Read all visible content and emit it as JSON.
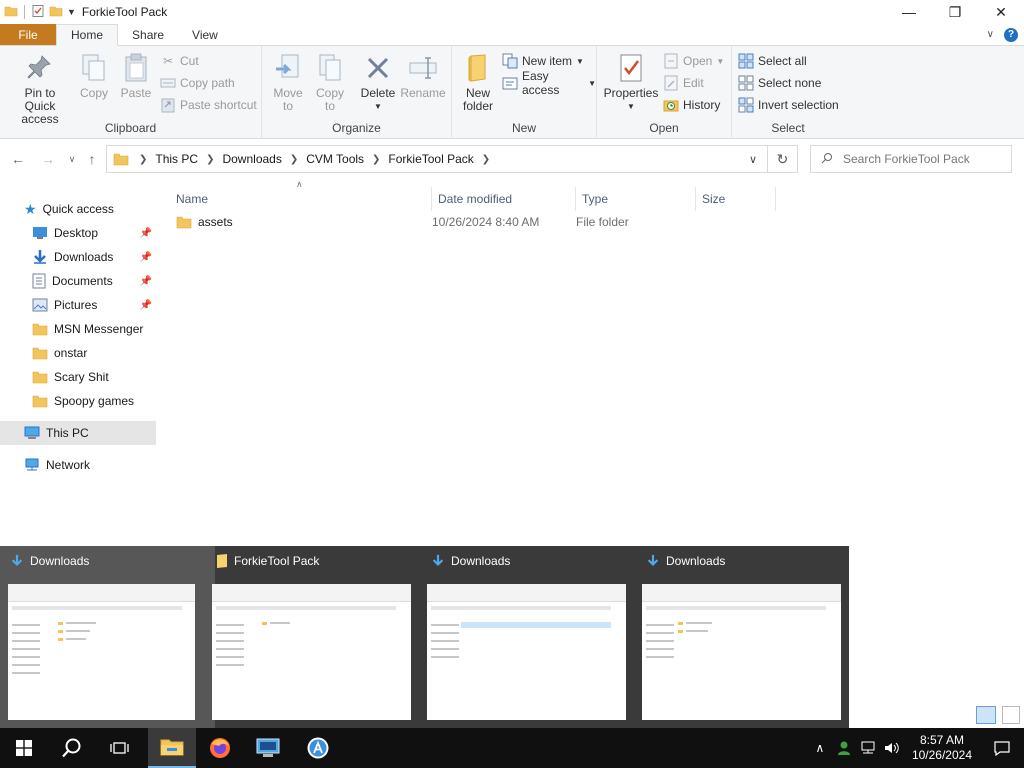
{
  "window": {
    "title": "ForkieTool Pack",
    "minimize": "—",
    "maximize": "❐",
    "close": "✕"
  },
  "tabs": [
    {
      "label": "File"
    },
    {
      "label": "Home"
    },
    {
      "label": "Share"
    },
    {
      "label": "View"
    }
  ],
  "ribbon": {
    "clipboard": {
      "label": "Clipboard",
      "pin": "Pin to Quick access",
      "copy": "Copy",
      "paste": "Paste",
      "cut": "Cut",
      "copy_path": "Copy path",
      "paste_shortcut": "Paste shortcut"
    },
    "organize": {
      "label": "Organize",
      "move_to": "Move to",
      "copy_to": "Copy to",
      "delete": "Delete",
      "rename": "Rename"
    },
    "new": {
      "label": "New",
      "new_folder": "New folder",
      "new_item": "New item",
      "easy_access": "Easy access"
    },
    "open": {
      "label": "Open",
      "properties": "Properties",
      "open": "Open",
      "edit": "Edit",
      "history": "History"
    },
    "select": {
      "label": "Select",
      "select_all": "Select all",
      "select_none": "Select none",
      "invert": "Invert selection"
    }
  },
  "address": {
    "crumbs": [
      "This PC",
      "Downloads",
      "CVM Tools",
      "ForkieTool Pack"
    ],
    "search_placeholder": "Search ForkieTool Pack"
  },
  "navpane": {
    "quick_access": "Quick access",
    "items": [
      {
        "label": "Desktop",
        "pinned": true
      },
      {
        "label": "Downloads",
        "pinned": true
      },
      {
        "label": "Documents",
        "pinned": true
      },
      {
        "label": "Pictures",
        "pinned": true
      },
      {
        "label": "MSN Messenger",
        "pinned": false
      },
      {
        "label": "onstar",
        "pinned": false
      },
      {
        "label": "Scary Shit",
        "pinned": false
      },
      {
        "label": "Spoopy games",
        "pinned": false
      }
    ],
    "this_pc": "This PC",
    "network": "Network"
  },
  "filelist": {
    "columns": [
      "Name",
      "Date modified",
      "Type",
      "Size"
    ],
    "rows": [
      {
        "name": "assets",
        "date": "10/26/2024 8:40 AM",
        "type": "File folder",
        "size": ""
      }
    ]
  },
  "thumbnails": [
    {
      "title": "Downloads",
      "icon": "download-icon"
    },
    {
      "title": "ForkieTool Pack",
      "icon": "folder-icon"
    },
    {
      "title": "Downloads",
      "icon": "download-icon"
    },
    {
      "title": "Downloads",
      "icon": "download-icon"
    }
  ],
  "taskbar": {
    "time": "8:57 AM",
    "date": "10/26/2024"
  },
  "colors": {
    "file_tab": "#c47a1e",
    "accent": "#1f6fc5",
    "folder": "#f2c55c"
  }
}
